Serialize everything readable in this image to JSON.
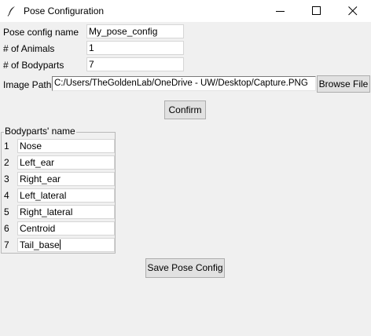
{
  "window": {
    "title": "Pose Configuration",
    "icon": "feather-icon"
  },
  "form": {
    "pose_config_name": {
      "label": "Pose config name",
      "value": "My_pose_config"
    },
    "num_animals": {
      "label": "# of Animals",
      "value": "1"
    },
    "num_bodyparts": {
      "label": "# of Bodyparts",
      "value": "7"
    },
    "image_path": {
      "label": "Image Path",
      "value": "C:/Users/TheGoldenLab/OneDrive - UW/Desktop/Capture.PNG"
    },
    "browse_label": "Browse File",
    "confirm_label": "Confirm"
  },
  "bodyparts": {
    "title": "Bodyparts' name",
    "items": [
      {
        "num": "1",
        "name": "Nose"
      },
      {
        "num": "2",
        "name": "Left_ear"
      },
      {
        "num": "3",
        "name": "Right_ear"
      },
      {
        "num": "4",
        "name": "Left_lateral"
      },
      {
        "num": "5",
        "name": "Right_lateral"
      },
      {
        "num": "6",
        "name": "Centroid"
      },
      {
        "num": "7",
        "name": "Tail_base"
      }
    ]
  },
  "save_label": "Save Pose Config"
}
